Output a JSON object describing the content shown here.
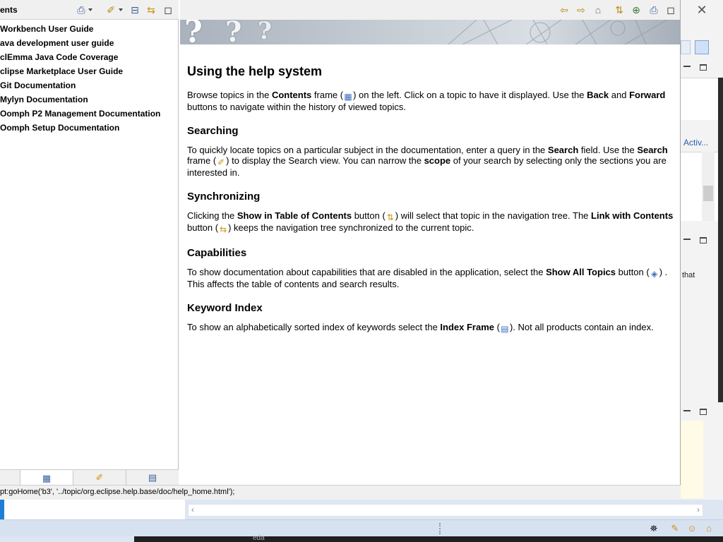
{
  "toc": {
    "title": "ents",
    "items": [
      "Workbench User Guide",
      "ava development user guide",
      "clEmma Java Code Coverage",
      "clipse Marketplace User Guide",
      "Git Documentation",
      "Mylyn Documentation",
      "Oomph P2 Management Documentation",
      "Oomph Setup Documentation"
    ]
  },
  "article": {
    "title": "Using the help system",
    "intro": {
      "t1": "Browse topics in the ",
      "b1": "Contents",
      "t2": " frame (",
      "t3": ") on the left. Click on a topic to have it displayed. Use the ",
      "b2": "Back",
      "t4": " and ",
      "b3": "Forward",
      "t5": " buttons to navigate within the history of viewed topics."
    },
    "searching": {
      "heading": "Searching",
      "t1": "To quickly locate topics on a particular subject in the documentation, enter a query in the ",
      "b1": "Search",
      "t2": " field. Use the ",
      "b2": "Search",
      "t3": " frame (",
      "t4": ") to display the Search view. You can narrow the ",
      "b3": "scope",
      "t5": " of your search by selecting only the sections you are interested in."
    },
    "synchronizing": {
      "heading": "Synchronizing",
      "t1": "Clicking the ",
      "b1": "Show in Table of Contents",
      "t2": " button (",
      "t3": ") will select that topic in the navigation tree. The ",
      "b2": "Link with Contents",
      "t4": " button (",
      "t5": ") keeps the navigation tree synchronized to the current topic."
    },
    "capabilities": {
      "heading": "Capabilities",
      "t1": "To show documentation about capabilities that are disabled in the application, select the ",
      "b1": "Show All Topics",
      "t2": " button (",
      "t3": ") . This affects the table of contents and search results."
    },
    "keyword": {
      "heading": "Keyword Index",
      "t1": "To show an alphabetically sorted index of keywords select the ",
      "b1": "Index Frame",
      "t2": " (",
      "t3": "). Not all products contain an index."
    }
  },
  "status": {
    "url_text": "pt:goHome('b3', '../topic/org.eclipse.help.base/doc/help_home.html');"
  },
  "ide": {
    "active_link": "Activ...",
    "that_text": "that",
    "taskbar_label": "eda"
  },
  "icons": {
    "print": "printer-icon",
    "highlight": "highlighter-icon",
    "collapse": "collapse-all-icon",
    "link": "link-with-contents-icon",
    "maximize": "maximize-icon",
    "back": "back-arrow-icon",
    "forward": "forward-arrow-icon",
    "home": "home-icon",
    "show_in_toc": "show-in-toc-icon",
    "bookmark": "bookmark-icon",
    "close": "close-icon"
  }
}
